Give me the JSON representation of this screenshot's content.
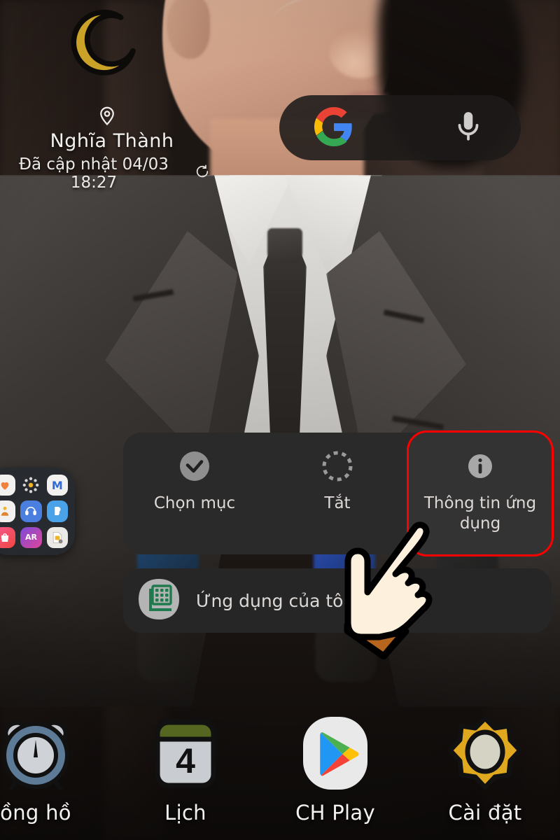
{
  "wallpaper": {
    "description": "blurred photo of a young man in a dark grey suit, white shirt and dark tie"
  },
  "weather_widget": {
    "icon": "crescent-moon-icon",
    "location_icon": "location-pin-icon",
    "location": "Nghĩa Thành",
    "updated": "Đã cập nhật 04/03 18:27",
    "refresh_icon": "refresh-icon",
    "moon_color": "#c9a227"
  },
  "google_widget": {
    "logo_icon": "google-g-icon",
    "mic_icon": "microphone-icon",
    "background": "#1c1a19"
  },
  "folder_preview": {
    "name": "samsung-folder",
    "apps": [
      {
        "name": "samsung-health-icon",
        "label": ""
      },
      {
        "name": "galaxy-themes-icon",
        "label": ""
      },
      {
        "name": "samsung-members-icon",
        "label": "M"
      },
      {
        "name": "samsung-kids-icon",
        "label": ""
      },
      {
        "name": "galaxy-wearable-icon",
        "label": ""
      },
      {
        "name": "bixby-icon",
        "label": ""
      },
      {
        "name": "galaxy-store-icon",
        "label": ""
      },
      {
        "name": "ar-zone-icon",
        "label": "AR"
      },
      {
        "name": "sim-toolkit-icon",
        "label": ""
      }
    ]
  },
  "context_menu": {
    "items": [
      {
        "label": "Chọn mục",
        "icon": "check-circle-icon",
        "highlighted": false
      },
      {
        "label": "Tắt",
        "icon": "dashed-circle-icon",
        "highlighted": false
      },
      {
        "label": "Thông tin ứng dụng",
        "icon": "info-circle-icon",
        "highlighted": true
      }
    ],
    "highlight_color": "#ff0000",
    "background": "#2a2a2a"
  },
  "my_apps_row": {
    "icon": "apps-grid-icon",
    "label": "Ứng dụng của tôi"
  },
  "cursor": {
    "name": "pointing-hand-cursor",
    "skin_color": "#fdf0dc",
    "sleeve_color": "#b5651d"
  },
  "dock": {
    "apps": [
      {
        "label": "ồng hồ",
        "icon": "alarm-clock-icon"
      },
      {
        "label": "Lịch",
        "icon": "calendar-icon",
        "day": "4"
      },
      {
        "label": "CH Play",
        "icon": "google-play-icon"
      },
      {
        "label": "Cài đặt",
        "icon": "settings-gear-icon"
      }
    ]
  }
}
